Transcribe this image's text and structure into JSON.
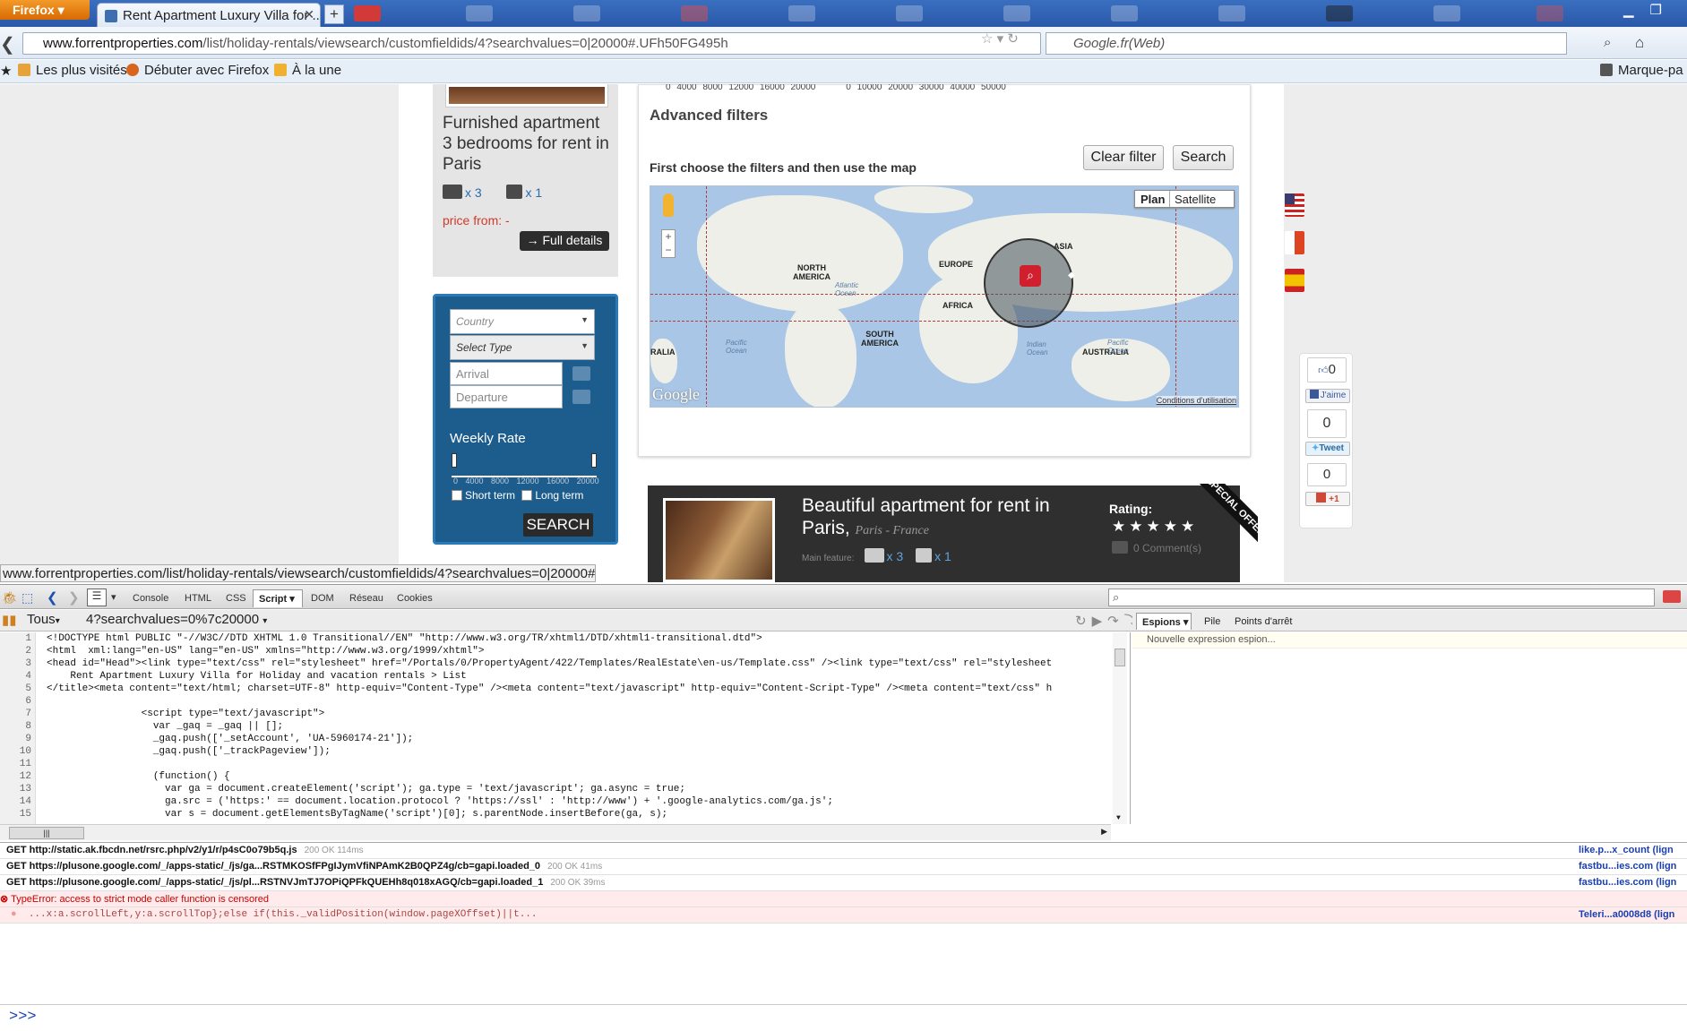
{
  "browser": {
    "menu_button": "Firefox",
    "tab_title": "Rent Apartment Luxury Villa for ...",
    "new_tab": "+",
    "url_host": "www.forrentproperties.com",
    "url_path": "/list/holiday-rentals/viewsearch/customfieldids/4?searchvalues=0|20000#.UFh50FG495h",
    "search_engine": "Google.fr(Web)",
    "bookmarks": [
      {
        "label": "Les plus visités",
        "color": "#e8a23a"
      },
      {
        "label": "Débuter avec Firefox",
        "color": "#d8641e"
      },
      {
        "label": "À la une",
        "color": "#f0b030"
      }
    ],
    "bookmark_right": "Marque-pa",
    "status_url": "www.forrentproperties.com/list/holiday-rentals/viewsearch/customfieldids/4?searchvalues=0|20000#"
  },
  "listing_card": {
    "title": "Furnished apartment 3 bedrooms for rent in Paris",
    "beds": "x 3",
    "baths": "x 1",
    "price_label": "price from:",
    "price_value": "-",
    "details_button": "→ Full details"
  },
  "search_widget": {
    "country_placeholder": "Country",
    "type_placeholder": "Select Type",
    "arrival_placeholder": "Arrival",
    "departure_placeholder": "Departure",
    "rate_label": "Weekly Rate",
    "rate_ticks": "0 4000 8000 12000 16000 20000",
    "short_term": "Short term",
    "long_term": "Long term",
    "search_button": "SEARCH"
  },
  "filters": {
    "hist_ticks_1": "0 4000 8000 12000 16000 20000",
    "hist_ticks_2": "0 10000 20000 30000 40000 50000",
    "advanced_title": "Advanced filters",
    "clear_button": "Clear filter",
    "search_button": "Search",
    "instruction": "First choose the filters and then use the map",
    "map_plan": "Plan",
    "map_satellite": "Satellite",
    "map_labels": [
      "NORTH AMERICA",
      "EUROPE",
      "ASIA",
      "AFRICA",
      "SOUTH AMERICA",
      "AUSTRALIA",
      "RALIA"
    ],
    "ocean_labels": [
      "Atlantic Ocean",
      "Pacific Ocean",
      "Indian Ocean",
      "Pacific Ocean"
    ],
    "map_logo": "Google",
    "map_terms": "Conditions d'utilisation"
  },
  "featured": {
    "title": "Beautiful apartment for rent in Paris,",
    "location": "Paris - France",
    "feature_label": "Main feature:",
    "beds": "x 3",
    "baths": "x 1",
    "rating_label": "Rating:",
    "stars": "★★★★★",
    "comments": "0 Comment(s)",
    "ribbon": "SPECIAL OFFER"
  },
  "social": {
    "like_count": "0",
    "like_button": "J'aime",
    "tweet_count": "0",
    "tweet_button": "Tweet",
    "plus_count": "0",
    "plus_button": "+1"
  },
  "firebug": {
    "tabs": [
      "Console",
      "HTML",
      "CSS",
      "Script",
      "DOM",
      "Réseau",
      "Cookies"
    ],
    "filter_all": "Tous",
    "script_file": "4?searchvalues=0%7c20000",
    "watch_tabs": [
      "Espions",
      "Pile",
      "Points d'arrêt"
    ],
    "new_watch": "Nouvelle expression espion...",
    "code_lines": [
      "<!DOCTYPE html PUBLIC \"-//W3C//DTD XHTML 1.0 Transitional//EN\" \"http://www.w3.org/TR/xhtml1/DTD/xhtml1-transitional.dtd\">",
      "<html  xml:lang=\"en-US\" lang=\"en-US\" xmlns=\"http://www.w3.org/1999/xhtml\">",
      "<head id=\"Head\"><link type=\"text/css\" rel=\"stylesheet\" href=\"/Portals/0/PropertyAgent/422/Templates/RealEstate\\en-us/Template.css\" /><link type=\"text/css\" rel=\"stylesheet",
      "    Rent Apartment Luxury Villa for Holiday and vacation rentals > List",
      "</title><meta content=\"text/html; charset=UTF-8\" http-equiv=\"Content-Type\" /><meta content=\"text/javascript\" http-equiv=\"Content-Script-Type\" /><meta content=\"text/css\" h",
      "",
      "                <script type=\"text/javascript\">",
      "                  var _gaq = _gaq || [];",
      "                  _gaq.push(['_setAccount', 'UA-5960174-21']);",
      "                  _gaq.push(['_trackPageview']);",
      "",
      "                  (function() {",
      "                    var ga = document.createElement('script'); ga.type = 'text/javascript'; ga.async = true;",
      "                    ga.src = ('https:' == document.location.protocol ? 'https://ssl' : 'http://www') + '.google-analytics.com/ga.js';",
      "                    var s = document.getElementsByTagName('script')[0]; s.parentNode.insertBefore(ga, s);"
    ],
    "console_rows": [
      {
        "req": "GET http://static.ak.fbcdn.net/rsrc.php/v2/y1/r/p4sC0o79b5q.js",
        "meta": "200 OK 114ms",
        "src": "like.p...x_count (lign"
      },
      {
        "req": "GET https://plusone.google.com/_/apps-static/_/js/ga...RSTMKOSfFPgIJymVfiNPAmK2B0QPZ4g/cb=gapi.loaded_0",
        "meta": "200 OK 41ms",
        "src": "fastbu...ies.com (lign"
      },
      {
        "req": "GET https://plusone.google.com/_/apps-static/_/js/pl...RSTNVJmTJ7OPiQPFkQUEHh8q018xAGQ/cb=gapi.loaded_1",
        "meta": "200 OK 39ms",
        "src": "fastbu...ies.com (lign"
      }
    ],
    "error_text": "TypeError: access to strict mode caller function is censored",
    "error_code": "...x:a.scrollLeft,y:a.scrollTop};else if(this._validPosition(window.pageXOffset)||t...",
    "error_src": "Teleri...a0008d8 (lign",
    "prompt": ">>>"
  }
}
